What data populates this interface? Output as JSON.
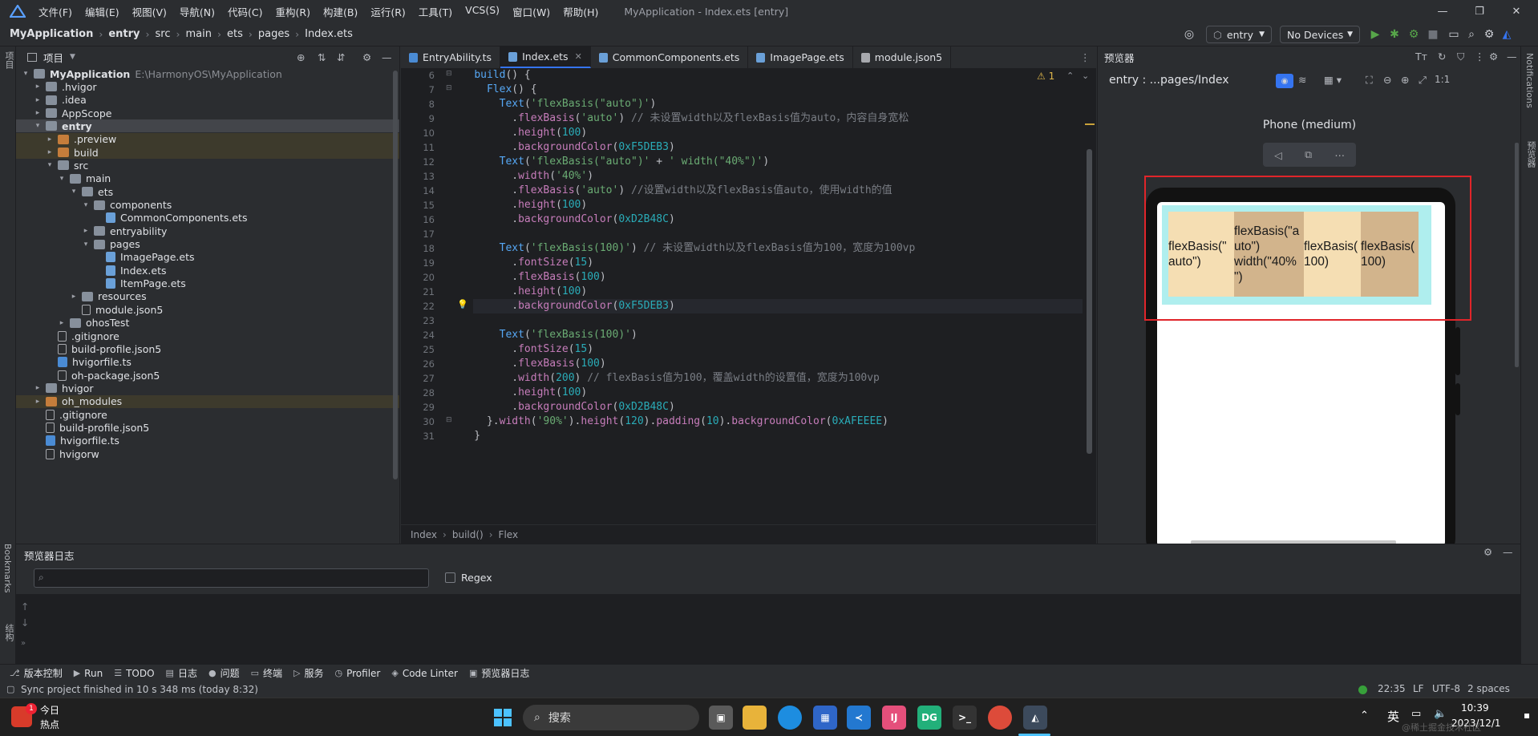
{
  "menu": {
    "items": [
      "文件(F)",
      "编辑(E)",
      "视图(V)",
      "导航(N)",
      "代码(C)",
      "重构(R)",
      "构建(B)",
      "运行(R)",
      "工具(T)",
      "VCS(S)",
      "窗口(W)",
      "帮助(H)"
    ],
    "app_title": "MyApplication - Index.ets [entry]"
  },
  "navbar": {
    "breadcrumb": [
      "MyApplication",
      "entry",
      "src",
      "main",
      "ets",
      "pages",
      "Index.ets"
    ],
    "run_config": "entry",
    "device": "No Devices"
  },
  "project": {
    "title": "项目",
    "tree": [
      {
        "depth": 0,
        "arrow": "▾",
        "icon": "folder",
        "label": "MyApplication",
        "extra": "E:\\HarmonyOS\\MyApplication",
        "bold": true
      },
      {
        "depth": 1,
        "arrow": "▸",
        "icon": "folder",
        "label": ".hvigor"
      },
      {
        "depth": 1,
        "arrow": "▸",
        "icon": "folder",
        "label": ".idea"
      },
      {
        "depth": 1,
        "arrow": "▸",
        "icon": "folder",
        "label": "AppScope"
      },
      {
        "depth": 1,
        "arrow": "▾",
        "icon": "folder",
        "label": "entry",
        "bold": true,
        "state": "sel"
      },
      {
        "depth": 2,
        "arrow": "▸",
        "icon": "folder-orange",
        "label": ".preview",
        "state": "hl"
      },
      {
        "depth": 2,
        "arrow": "▸",
        "icon": "folder-orange",
        "label": "build",
        "state": "hl"
      },
      {
        "depth": 2,
        "arrow": "▾",
        "icon": "folder",
        "label": "src"
      },
      {
        "depth": 3,
        "arrow": "▾",
        "icon": "folder",
        "label": "main"
      },
      {
        "depth": 4,
        "arrow": "▾",
        "icon": "folder",
        "label": "ets"
      },
      {
        "depth": 5,
        "arrow": "▾",
        "icon": "folder",
        "label": "components"
      },
      {
        "depth": 6,
        "arrow": "",
        "icon": "file-ets",
        "label": "CommonComponents.ets"
      },
      {
        "depth": 5,
        "arrow": "▸",
        "icon": "folder",
        "label": "entryability"
      },
      {
        "depth": 5,
        "arrow": "▾",
        "icon": "folder",
        "label": "pages"
      },
      {
        "depth": 6,
        "arrow": "",
        "icon": "file-ets",
        "label": "ImagePage.ets"
      },
      {
        "depth": 6,
        "arrow": "",
        "icon": "file-ets",
        "label": "Index.ets"
      },
      {
        "depth": 6,
        "arrow": "",
        "icon": "file-ets",
        "label": "ItemPage.ets"
      },
      {
        "depth": 4,
        "arrow": "▸",
        "icon": "folder",
        "label": "resources"
      },
      {
        "depth": 4,
        "arrow": "",
        "icon": "file-json",
        "label": "module.json5"
      },
      {
        "depth": 3,
        "arrow": "▸",
        "icon": "folder",
        "label": "ohosTest"
      },
      {
        "depth": 2,
        "arrow": "",
        "icon": "file-json",
        "label": ".gitignore"
      },
      {
        "depth": 2,
        "arrow": "",
        "icon": "file-json",
        "label": "build-profile.json5"
      },
      {
        "depth": 2,
        "arrow": "",
        "icon": "file-ts",
        "label": "hvigorfile.ts"
      },
      {
        "depth": 2,
        "arrow": "",
        "icon": "file-json",
        "label": "oh-package.json5"
      },
      {
        "depth": 1,
        "arrow": "▸",
        "icon": "folder",
        "label": "hvigor"
      },
      {
        "depth": 1,
        "arrow": "▸",
        "icon": "folder-orange",
        "label": "oh_modules",
        "state": "hl"
      },
      {
        "depth": 1,
        "arrow": "",
        "icon": "file-json",
        "label": ".gitignore"
      },
      {
        "depth": 1,
        "arrow": "",
        "icon": "file-json",
        "label": "build-profile.json5"
      },
      {
        "depth": 1,
        "arrow": "",
        "icon": "file-ts",
        "label": "hvigorfile.ts"
      },
      {
        "depth": 1,
        "arrow": "",
        "icon": "file-json",
        "label": "hvigorw"
      }
    ]
  },
  "editor": {
    "tabs": [
      {
        "label": "EntryAbility.ts",
        "active": false,
        "color": "#4a8bd4"
      },
      {
        "label": "Index.ets",
        "active": true,
        "color": "#6aa0d8"
      },
      {
        "label": "CommonComponents.ets",
        "active": false,
        "color": "#6aa0d8"
      },
      {
        "label": "ImagePage.ets",
        "active": false,
        "color": "#6aa0d8"
      },
      {
        "label": "module.json5",
        "active": false,
        "color": "#a7a9ae"
      }
    ],
    "warning_count": "1",
    "lines": [
      {
        "n": "6",
        "t": [
          [
            "    ",
            "plain"
          ],
          [
            "build",
            "fn"
          ],
          [
            "() {",
            "plain"
          ]
        ]
      },
      {
        "n": "7",
        "t": [
          [
            "      ",
            "plain"
          ],
          [
            "Flex",
            "fn"
          ],
          [
            "() {",
            "plain"
          ]
        ]
      },
      {
        "n": "8",
        "t": [
          [
            "        ",
            "plain"
          ],
          [
            "Text",
            "fn"
          ],
          [
            "(",
            "plain"
          ],
          [
            "'flexBasis(\"auto\")'",
            "str"
          ],
          [
            ")",
            "plain"
          ]
        ]
      },
      {
        "n": "9",
        "t": [
          [
            "          .",
            "plain"
          ],
          [
            "flexBasis",
            "call"
          ],
          [
            "(",
            "plain"
          ],
          [
            "'auto'",
            "str"
          ],
          [
            ") ",
            "plain"
          ],
          [
            "// 未设置width以及flexBasis值为auto，内容自身宽松",
            "cmt"
          ]
        ]
      },
      {
        "n": "10",
        "t": [
          [
            "          .",
            "plain"
          ],
          [
            "height",
            "call"
          ],
          [
            "(",
            "plain"
          ],
          [
            "100",
            "num"
          ],
          [
            ")",
            "plain"
          ]
        ]
      },
      {
        "n": "11",
        "t": [
          [
            "          .",
            "plain"
          ],
          [
            "backgroundColor",
            "call"
          ],
          [
            "(",
            "plain"
          ],
          [
            "0xF5DEB3",
            "num"
          ],
          [
            ")",
            "plain"
          ]
        ]
      },
      {
        "n": "12",
        "t": [
          [
            "        ",
            "plain"
          ],
          [
            "Text",
            "fn"
          ],
          [
            "(",
            "plain"
          ],
          [
            "'flexBasis(\"auto\")'",
            "str"
          ],
          [
            " + ",
            "plain"
          ],
          [
            "' width(\"40%\")'",
            "str"
          ],
          [
            ")",
            "plain"
          ]
        ]
      },
      {
        "n": "13",
        "t": [
          [
            "          .",
            "plain"
          ],
          [
            "width",
            "call"
          ],
          [
            "(",
            "plain"
          ],
          [
            "'40%'",
            "str"
          ],
          [
            ")",
            "plain"
          ]
        ]
      },
      {
        "n": "14",
        "t": [
          [
            "          .",
            "plain"
          ],
          [
            "flexBasis",
            "call"
          ],
          [
            "(",
            "plain"
          ],
          [
            "'auto'",
            "str"
          ],
          [
            ") ",
            "plain"
          ],
          [
            "//设置width以及flexBasis值auto，使用width的值",
            "cmt"
          ]
        ]
      },
      {
        "n": "15",
        "t": [
          [
            "          .",
            "plain"
          ],
          [
            "height",
            "call"
          ],
          [
            "(",
            "plain"
          ],
          [
            "100",
            "num"
          ],
          [
            ")",
            "plain"
          ]
        ]
      },
      {
        "n": "16",
        "t": [
          [
            "          .",
            "plain"
          ],
          [
            "backgroundColor",
            "call"
          ],
          [
            "(",
            "plain"
          ],
          [
            "0xD2B48C",
            "num"
          ],
          [
            ")",
            "plain"
          ]
        ]
      },
      {
        "n": "17",
        "t": []
      },
      {
        "n": "18",
        "t": [
          [
            "        ",
            "plain"
          ],
          [
            "Text",
            "fn"
          ],
          [
            "(",
            "plain"
          ],
          [
            "'flexBasis(100)'",
            "str"
          ],
          [
            ") ",
            "plain"
          ],
          [
            "// 未设置width以及flexBasis值为100，宽度为100vp",
            "cmt"
          ]
        ]
      },
      {
        "n": "19",
        "t": [
          [
            "          .",
            "plain"
          ],
          [
            "fontSize",
            "call"
          ],
          [
            "(",
            "plain"
          ],
          [
            "15",
            "num"
          ],
          [
            ")",
            "plain"
          ]
        ]
      },
      {
        "n": "20",
        "t": [
          [
            "          .",
            "plain"
          ],
          [
            "flexBasis",
            "call"
          ],
          [
            "(",
            "plain"
          ],
          [
            "100",
            "num"
          ],
          [
            ")",
            "plain"
          ]
        ]
      },
      {
        "n": "21",
        "t": [
          [
            "          .",
            "plain"
          ],
          [
            "height",
            "call"
          ],
          [
            "(",
            "plain"
          ],
          [
            "100",
            "num"
          ],
          [
            ")",
            "plain"
          ]
        ]
      },
      {
        "n": "22",
        "t": [
          [
            "          .",
            "plain"
          ],
          [
            "backgroundColor",
            "call"
          ],
          [
            "(",
            "plain"
          ],
          [
            "0xF5DEB3",
            "num"
          ],
          [
            ")",
            "plain"
          ]
        ],
        "current": true
      },
      {
        "n": "23",
        "t": []
      },
      {
        "n": "24",
        "t": [
          [
            "        ",
            "plain"
          ],
          [
            "Text",
            "fn"
          ],
          [
            "(",
            "plain"
          ],
          [
            "'flexBasis(100)'",
            "str"
          ],
          [
            ")",
            "plain"
          ]
        ]
      },
      {
        "n": "25",
        "t": [
          [
            "          .",
            "plain"
          ],
          [
            "fontSize",
            "call"
          ],
          [
            "(",
            "plain"
          ],
          [
            "15",
            "num"
          ],
          [
            ")",
            "plain"
          ]
        ]
      },
      {
        "n": "26",
        "t": [
          [
            "          .",
            "plain"
          ],
          [
            "flexBasis",
            "call"
          ],
          [
            "(",
            "plain"
          ],
          [
            "100",
            "num"
          ],
          [
            ")",
            "plain"
          ]
        ]
      },
      {
        "n": "27",
        "t": [
          [
            "          .",
            "plain"
          ],
          [
            "width",
            "call"
          ],
          [
            "(",
            "plain"
          ],
          [
            "200",
            "num"
          ],
          [
            ") ",
            "plain"
          ],
          [
            "// flexBasis值为100，覆盖width的设置值，宽度为100vp",
            "cmt"
          ]
        ]
      },
      {
        "n": "28",
        "t": [
          [
            "          .",
            "plain"
          ],
          [
            "height",
            "call"
          ],
          [
            "(",
            "plain"
          ],
          [
            "100",
            "num"
          ],
          [
            ")",
            "plain"
          ]
        ]
      },
      {
        "n": "29",
        "t": [
          [
            "          .",
            "plain"
          ],
          [
            "backgroundColor",
            "call"
          ],
          [
            "(",
            "plain"
          ],
          [
            "0xD2B48C",
            "num"
          ],
          [
            ")",
            "plain"
          ]
        ]
      },
      {
        "n": "30",
        "t": [
          [
            "      }.",
            "plain"
          ],
          [
            "width",
            "call"
          ],
          [
            "(",
            "plain"
          ],
          [
            "'90%'",
            "str"
          ],
          [
            ").",
            "plain"
          ],
          [
            "height",
            "call"
          ],
          [
            "(",
            "plain"
          ],
          [
            "120",
            "num"
          ],
          [
            ").",
            "plain"
          ],
          [
            "padding",
            "call"
          ],
          [
            "(",
            "plain"
          ],
          [
            "10",
            "num"
          ],
          [
            ").",
            "plain"
          ],
          [
            "backgroundColor",
            "call"
          ],
          [
            "(",
            "plain"
          ],
          [
            "0xAFEEEE",
            "num"
          ],
          [
            ")",
            "plain"
          ]
        ]
      },
      {
        "n": "31",
        "t": [
          [
            "    }",
            "plain"
          ]
        ]
      }
    ],
    "breadcrumb": [
      "Index",
      "build()",
      "Flex"
    ]
  },
  "preview": {
    "title": "预览器",
    "path": "entry : ...pages/Index",
    "device": "Phone (medium)",
    "boxes": [
      {
        "lines": [
          "flexBasis(\"",
          "auto\")"
        ],
        "color": "#F5DEB3"
      },
      {
        "lines": [
          "flexBasis(\"a",
          "uto\")",
          "width(\"40%",
          "\")"
        ],
        "color": "#D2B48C"
      },
      {
        "lines": [
          "flexBasis(",
          "100)"
        ],
        "color": "#F5DEB3"
      },
      {
        "lines": [
          "flexBasis(",
          "100)"
        ],
        "color": "#D2B48C"
      }
    ],
    "container_color": "#AFEEEE"
  },
  "log": {
    "title": "预览器日志",
    "regex_label": "Regex"
  },
  "left_strip": {
    "project_label": "项目",
    "bookmarks_label": "Bookmarks",
    "structure_label": "结构"
  },
  "right_strip": {
    "notifications_label": "Notifications",
    "previewer_label": "预览器"
  },
  "toolwindows": [
    {
      "icon": "⎇",
      "label": "版本控制"
    },
    {
      "icon": "▶",
      "label": "Run"
    },
    {
      "icon": "☰",
      "label": "TODO"
    },
    {
      "icon": "▤",
      "label": "日志"
    },
    {
      "icon": "●",
      "label": "问题"
    },
    {
      "icon": "▭",
      "label": "终端"
    },
    {
      "icon": "▷",
      "label": "服务"
    },
    {
      "icon": "◷",
      "label": "Profiler"
    },
    {
      "icon": "◈",
      "label": "Code Linter"
    },
    {
      "icon": "▣",
      "label": "预览器日志"
    }
  ],
  "status": {
    "message": "Sync project finished in 10 s 348 ms (today 8:32)",
    "position": "22:35",
    "line_sep": "LF",
    "encoding": "UTF-8",
    "indent": "2 spaces"
  },
  "taskbar": {
    "weather_badge": "1",
    "weather_title": "今日",
    "weather_sub": "热点",
    "search": "搜索",
    "ime": "英",
    "time": "10:39",
    "date": "2023/12/1",
    "watermark": "@稀土掘金技术社区"
  }
}
